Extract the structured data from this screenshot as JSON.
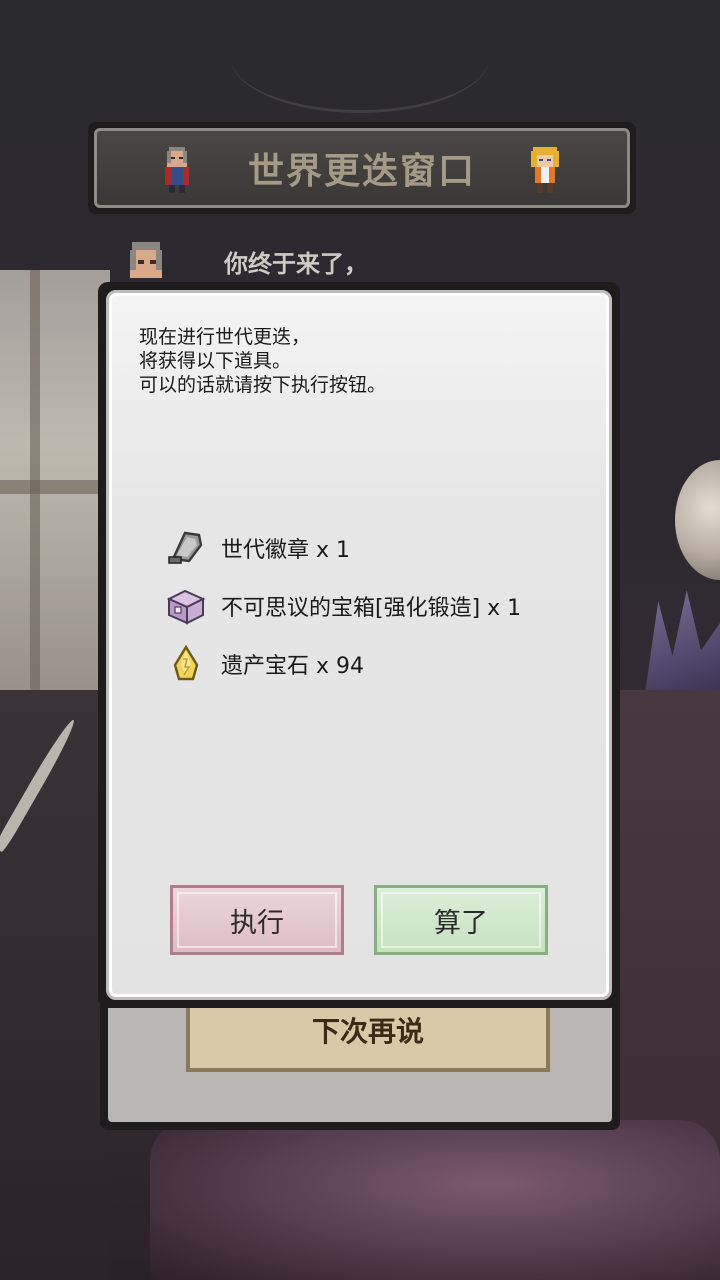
{
  "header": {
    "title": "世界更迭窗口"
  },
  "background_dialogue": {
    "text": "你终于来了，",
    "later_button_label": "下次再说"
  },
  "dialog": {
    "message_lines": [
      "现在进行世代更迭，",
      "将获得以下道具。",
      "可以的话就请按下执行按钮。"
    ],
    "rewards": [
      {
        "icon": "badge-icon",
        "label": "世代徽章 x 1"
      },
      {
        "icon": "treasure-chest-icon",
        "label": "不可思议的宝箱[强化锻造] x 1"
      },
      {
        "icon": "gem-icon",
        "label": "遗产宝石 x 94"
      }
    ],
    "execute_label": "执行",
    "cancel_label": "算了"
  },
  "colors": {
    "header_title": "#a49a86",
    "execute_button": "#dcbcc6",
    "cancel_button": "#c6e1c0"
  }
}
